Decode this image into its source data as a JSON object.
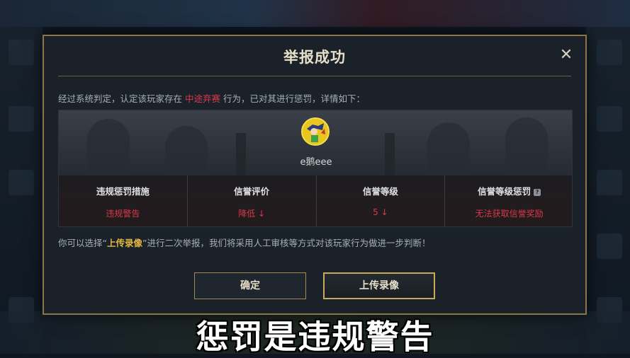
{
  "dialog": {
    "title": "举报成功",
    "close_symbol": "✕",
    "judge_prefix": "经过系统判定，认定该玩家存在",
    "judge_violation": "中途弃赛",
    "judge_suffix": "行为，已对其进行惩罚，详情如下：",
    "player_name": "e鹅eee",
    "stats": [
      {
        "header": "违规惩罚措施",
        "value": "违规警告"
      },
      {
        "header": "信誉评价",
        "value": "降低 ↓"
      },
      {
        "header": "信誉等级",
        "value": "5 ↓"
      },
      {
        "header": "信誉等级惩罚",
        "value": "无法获取信誉奖励",
        "help": "?"
      }
    ],
    "appeal_prefix": "你可以选择“",
    "appeal_link": "上传录像",
    "appeal_suffix": "”进行二次举报，我们将采用人工审核等方式对该玩家行为做进一步判断！",
    "confirm_label": "确定",
    "upload_label": "上传录像"
  },
  "caption": "惩罚是违规警告",
  "colors": {
    "accent_gold": "#c9a95a",
    "warning_red": "#d8394a",
    "link_gold": "#e6b73f"
  }
}
